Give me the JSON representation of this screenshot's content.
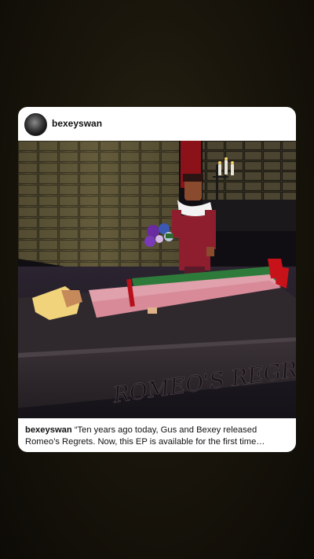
{
  "post": {
    "username": "bexeyswan",
    "image_text": "ROMEO'S REGRETS",
    "caption_user": "bexeyswan",
    "caption_text": "“Ten years ago today, Gus and Bexey released Romeo’s Regrets. Now, this EP is available for the first time…"
  },
  "colors": {
    "background": "#1a160c",
    "card": "#ffffff",
    "text": "#111111"
  }
}
